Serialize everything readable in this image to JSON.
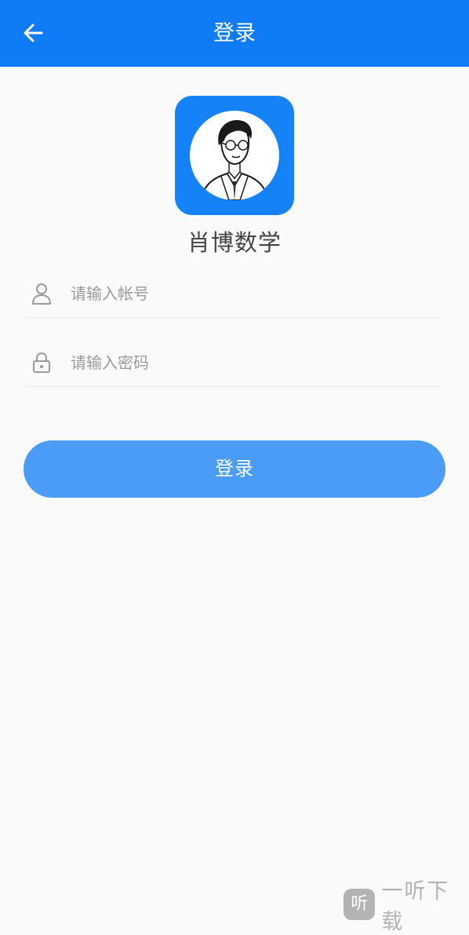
{
  "header": {
    "title": "登录",
    "back_icon": "arrow-left-icon"
  },
  "app": {
    "name": "肖博数学",
    "logo_icon": "teacher-portrait-logo"
  },
  "form": {
    "account": {
      "icon": "user-icon",
      "placeholder": "请输入帐号",
      "value": ""
    },
    "password": {
      "icon": "lock-icon",
      "placeholder": "请输入密码",
      "value": ""
    },
    "login_label": "登录"
  },
  "watermark": {
    "logo_char": "听",
    "text": "一听下载"
  },
  "colors": {
    "header": "#0f7cf6",
    "logo_bg": "#1583f7",
    "button": "#4a9cf7",
    "background": "#fafafa"
  }
}
